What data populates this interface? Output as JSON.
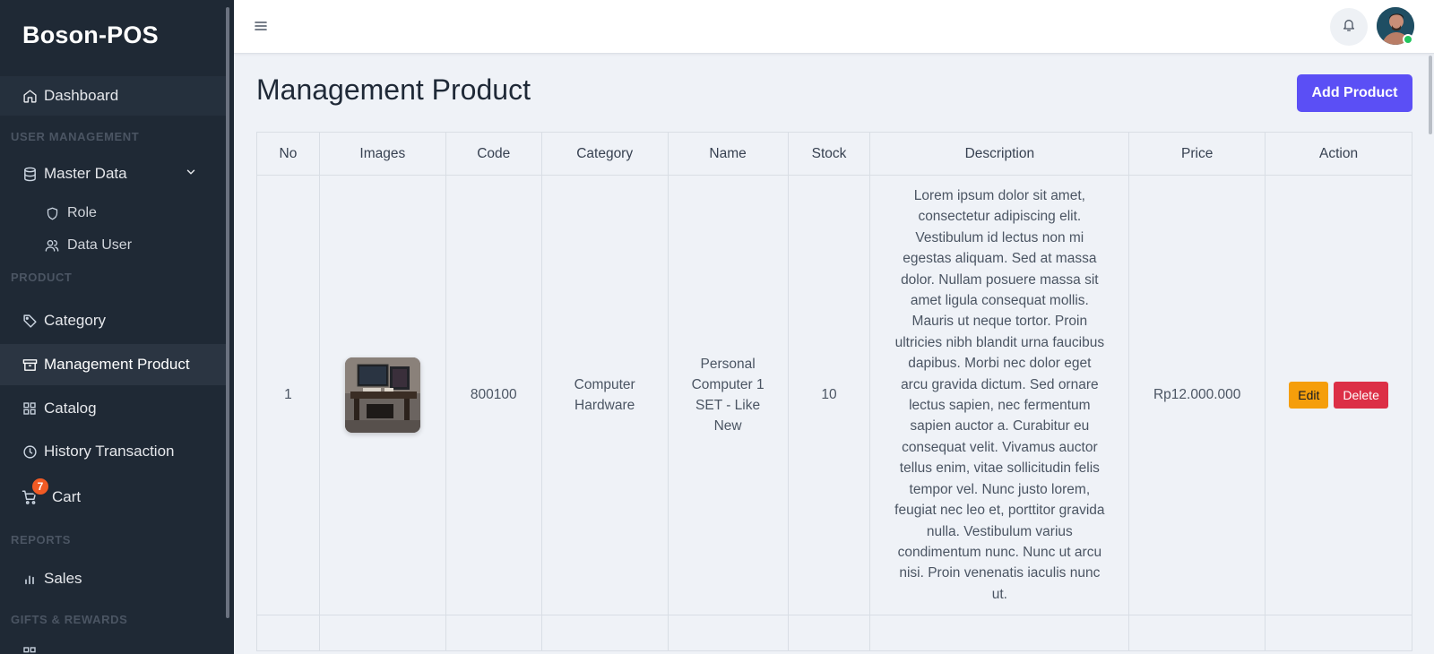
{
  "brand": "Boson-POS",
  "sidebar": {
    "dashboard": "Dashboard",
    "sections": {
      "user_management": "USER MANAGEMENT",
      "product": "PRODUCT",
      "reports": "REPORTS",
      "gifts": "GIFTS & REWARDS"
    },
    "master_data": "Master Data",
    "role": "Role",
    "data_user": "Data User",
    "category": "Category",
    "management_product": "Management Product",
    "catalog": "Catalog",
    "history_transaction": "History Transaction",
    "cart": "Cart",
    "cart_count": "7",
    "sales": "Sales"
  },
  "page": {
    "title": "Management Product",
    "add_button": "Add Product"
  },
  "table": {
    "headers": [
      "No",
      "Images",
      "Code",
      "Category",
      "Name",
      "Stock",
      "Description",
      "Price",
      "Action"
    ],
    "rows": [
      {
        "no": "1",
        "code": "800100",
        "category": "Computer Hardware",
        "name": "Personal Computer 1 SET - Like New",
        "stock": "10",
        "description": "Lorem ipsum dolor sit amet, consectetur adipiscing elit. Vestibulum id lectus non mi egestas aliquam. Sed at massa dolor. Nullam posuere massa sit amet ligula consequat mollis. Mauris ut neque tortor. Proin ultricies nibh blandit urna faucibus dapibus. Morbi nec dolor eget arcu gravida dictum. Sed ornare lectus sapien, nec fermentum sapien auctor a. Curabitur eu consequat velit. Vivamus auctor tellus enim, vitae sollicitudin felis tempor vel. Nunc justo lorem, feugiat nec leo et, porttitor gravida nulla. Vestibulum varius condimentum nunc. Nunc ut arcu nisi. Proin venenatis iaculis nunc ut.",
        "price": "Rp12.000.000",
        "edit_label": "Edit",
        "delete_label": "Delete"
      }
    ]
  },
  "colors": {
    "sidebar_bg": "#1f2935",
    "primary": "#5b4ff5",
    "edit": "#f59e0b",
    "delete": "#dc2f46",
    "badge": "#f15a24",
    "online": "#22c55e"
  },
  "icons": [
    "home-icon",
    "database-icon",
    "chevron-down-icon",
    "shield-icon",
    "users-icon",
    "tag-icon",
    "archive-icon",
    "grid-icon",
    "clock-icon",
    "cart-icon",
    "bar-chart-icon",
    "menu-icon",
    "bell-icon"
  ]
}
